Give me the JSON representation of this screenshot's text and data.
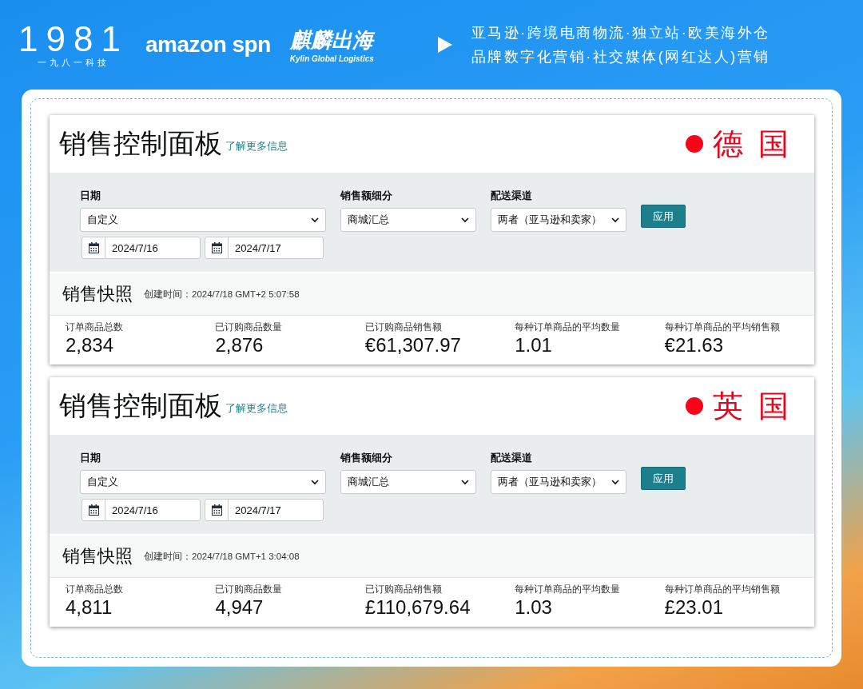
{
  "header": {
    "brand": {
      "mark": "1981",
      "caption": "一九八一科技"
    },
    "amazon": {
      "text": "amazon spn"
    },
    "kylin": {
      "name": "麒麟出海",
      "caption": "Kylin Global Logistics"
    },
    "slogan": [
      "亚马逊·跨境电商物流·独立站·欧美海外仓",
      "品牌数字化营销·社交媒体(网红达人)营销"
    ]
  },
  "panels": [
    {
      "title": "销售控制面板",
      "learn_more": "了解更多信息",
      "country": "德 国",
      "date": {
        "label": "日期",
        "value": "自定义",
        "start": "2024/7/16",
        "end": "2024/7/17"
      },
      "breakdown": {
        "label": "销售额细分",
        "value": "商城汇总"
      },
      "channel": {
        "label": "配送渠道",
        "value": "两者（亚马逊和卖家）"
      },
      "apply": "应用",
      "snapshot": {
        "title": "销售快照",
        "created": "创建时间：2024/7/18 GMT+2 5:07:58"
      },
      "metrics": [
        {
          "label": "订单商品总数",
          "value": "2,834"
        },
        {
          "label": "已订购商品数量",
          "value": "2,876"
        },
        {
          "label": "已订购商品销售额",
          "value": "€61,307.97"
        },
        {
          "label": "每种订单商品的平均数量",
          "value": "1.01"
        },
        {
          "label": "每种订单商品的平均销售额",
          "value": "€21.63"
        }
      ]
    },
    {
      "title": "销售控制面板",
      "learn_more": "了解更多信息",
      "country": "英 国",
      "date": {
        "label": "日期",
        "value": "自定义",
        "start": "2024/7/16",
        "end": "2024/7/17"
      },
      "breakdown": {
        "label": "销售额细分",
        "value": "商城汇总"
      },
      "channel": {
        "label": "配送渠道",
        "value": "两者（亚马逊和卖家）"
      },
      "apply": "应用",
      "snapshot": {
        "title": "销售快照",
        "created": "创建时间：2024/7/18 GMT+1 3:04:08"
      },
      "metrics": [
        {
          "label": "订单商品总数",
          "value": "4,811"
        },
        {
          "label": "已订购商品数量",
          "value": "4,947"
        },
        {
          "label": "已订购商品销售额",
          "value": "£110,679.64"
        },
        {
          "label": "每种订单商品的平均数量",
          "value": "1.03"
        },
        {
          "label": "每种订单商品的平均销售额",
          "value": "£23.01"
        }
      ]
    }
  ]
}
